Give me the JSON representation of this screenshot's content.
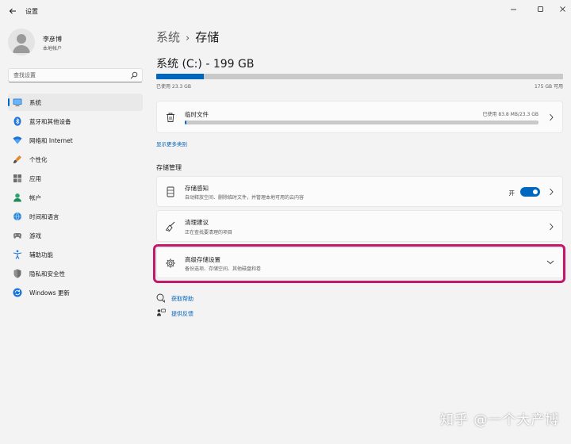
{
  "app": {
    "title": "设置"
  },
  "user": {
    "name": "李彦博",
    "account": "本地帐户"
  },
  "search": {
    "placeholder": "查找设置"
  },
  "sidebar": {
    "items": [
      {
        "label": "系统",
        "icon": "system-icon",
        "active": true
      },
      {
        "label": "蓝牙和其他设备",
        "icon": "bluetooth-icon"
      },
      {
        "label": "网络和 Internet",
        "icon": "network-icon"
      },
      {
        "label": "个性化",
        "icon": "personalization-icon"
      },
      {
        "label": "应用",
        "icon": "apps-icon"
      },
      {
        "label": "帐户",
        "icon": "accounts-icon"
      },
      {
        "label": "时间和语言",
        "icon": "time-language-icon"
      },
      {
        "label": "游戏",
        "icon": "gaming-icon"
      },
      {
        "label": "辅助功能",
        "icon": "accessibility-icon"
      },
      {
        "label": "隐私和安全性",
        "icon": "privacy-icon"
      },
      {
        "label": "Windows 更新",
        "icon": "windows-update-icon"
      }
    ]
  },
  "breadcrumb": {
    "parent": "系统",
    "separator": "›",
    "current": "存储"
  },
  "drive": {
    "title": "系统 (C:) - 199 GB",
    "used_label": "已使用 23.3 GB",
    "available_label": "175 GB 可用",
    "used_fraction": 0.117
  },
  "temp_files": {
    "title": "临时文件",
    "usage": "已使用 83.8 MB/23.3 GB",
    "used_fraction": 0.004
  },
  "links": {
    "show_more_categories": "显示更多类别"
  },
  "storage_management": {
    "heading": "存储管理",
    "storage_sense": {
      "title": "存储感知",
      "subtitle": "自动释放空间、删除临时文件，并管理本地可用的云内容",
      "toggle_label": "开",
      "toggle_on": true
    },
    "cleanup": {
      "title": "清理建议",
      "subtitle": "正在查找要清理的项目"
    },
    "advanced": {
      "title": "高级存储设置",
      "subtitle": "备份选项、存储空间、其他磁盘和卷"
    }
  },
  "help": {
    "get_help": "获取帮助",
    "feedback": "提供反馈"
  },
  "watermark": {
    "text": "知乎 @一个大产博"
  },
  "colors": {
    "accent": "#0067c0",
    "highlight_border": "#c2186b",
    "background": "#f3f3f3",
    "card": "#fbfbfb"
  }
}
